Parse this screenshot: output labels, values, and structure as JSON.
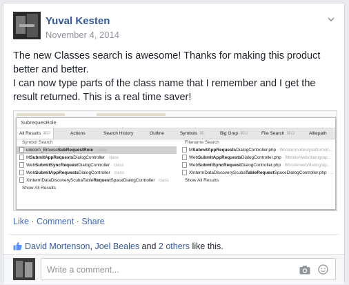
{
  "post": {
    "author": "Yuval Kesten",
    "date": "November 4, 2014",
    "text1": "The new Classes search is awesome! Thanks for making this product better and better.",
    "text2": "I can now type parts of the class name that I remember and I get the result returned. This is a real time saver!"
  },
  "attachment": {
    "search_value": "SubrequesRole",
    "tabs": [
      {
        "label": "All Results",
        "shortcut": "⌘P"
      },
      {
        "label": "Actions",
        "shortcut": ""
      },
      {
        "label": "Search History",
        "shortcut": ""
      },
      {
        "label": "Outline",
        "shortcut": ""
      },
      {
        "label": "Symbols",
        "shortcut": "⌘;"
      },
      {
        "label": "Big Grep",
        "shortcut": "⌘U"
      },
      {
        "label": "File Search",
        "shortcut": "⌘O"
      },
      {
        "label": "Alltepath",
        "shortcut": ""
      }
    ],
    "symbol_header": "Symbol Search",
    "symbol_rows": [
      {
        "pre": "unicorn_Browse",
        "bold": "SubRequestRole",
        "post": "",
        "path": " · class"
      },
      {
        "pre": "M",
        "bold": "SubmitAppRequests",
        "post": "DialogController",
        "path": " · class"
      },
      {
        "pre": "Web",
        "bold": "SubmitSyncRequest",
        "post": "DialogController",
        "path": " · class"
      },
      {
        "pre": "Web",
        "bold": "SubmitAppRequests",
        "post": "DialogController",
        "path": " · class"
      },
      {
        "pre": "XIntermDataDiscoveryScubaTable",
        "bold": "Request",
        "post": "SpaceDialogController",
        "path": " · class"
      }
    ],
    "symbol_more": "Show All Results",
    "file_header": "Filename Search",
    "file_rows": [
      {
        "pre": "M",
        "bold": "SubmitAppRequests",
        "post": "DialogController.php",
        "path": " · flib/site/mobile/platform/d..."
      },
      {
        "pre": "Web",
        "bold": "SubmitAppRequests",
        "post": "DialogController.php",
        "path": " · flib/site/web/dialog/ap..."
      },
      {
        "pre": "Web",
        "bold": "SubmitSyncRequest",
        "post": "DialogController.php",
        "path": " · flib/site/web/dialog/ap..."
      },
      {
        "pre": "XIntermDataDiscoveryScuba",
        "bold": "TableRequest",
        "post": "SpaceDialogController.php",
        "path": " · ..."
      }
    ],
    "file_more": "Show All Results"
  },
  "actions": {
    "like": "Like",
    "sep1": " · ",
    "comment": "Comment",
    "sep2": " · ",
    "share": "Share"
  },
  "likes": {
    "user1": "David Mortenson",
    "sep": ", ",
    "user2": "Joel Beales",
    "and": " and ",
    "others": "2 others",
    "suffix": " like this."
  },
  "comment_box": {
    "placeholder": "Write a comment..."
  },
  "colors": {
    "link": "#365899",
    "muted": "#90949c",
    "text": "#1d2129"
  }
}
